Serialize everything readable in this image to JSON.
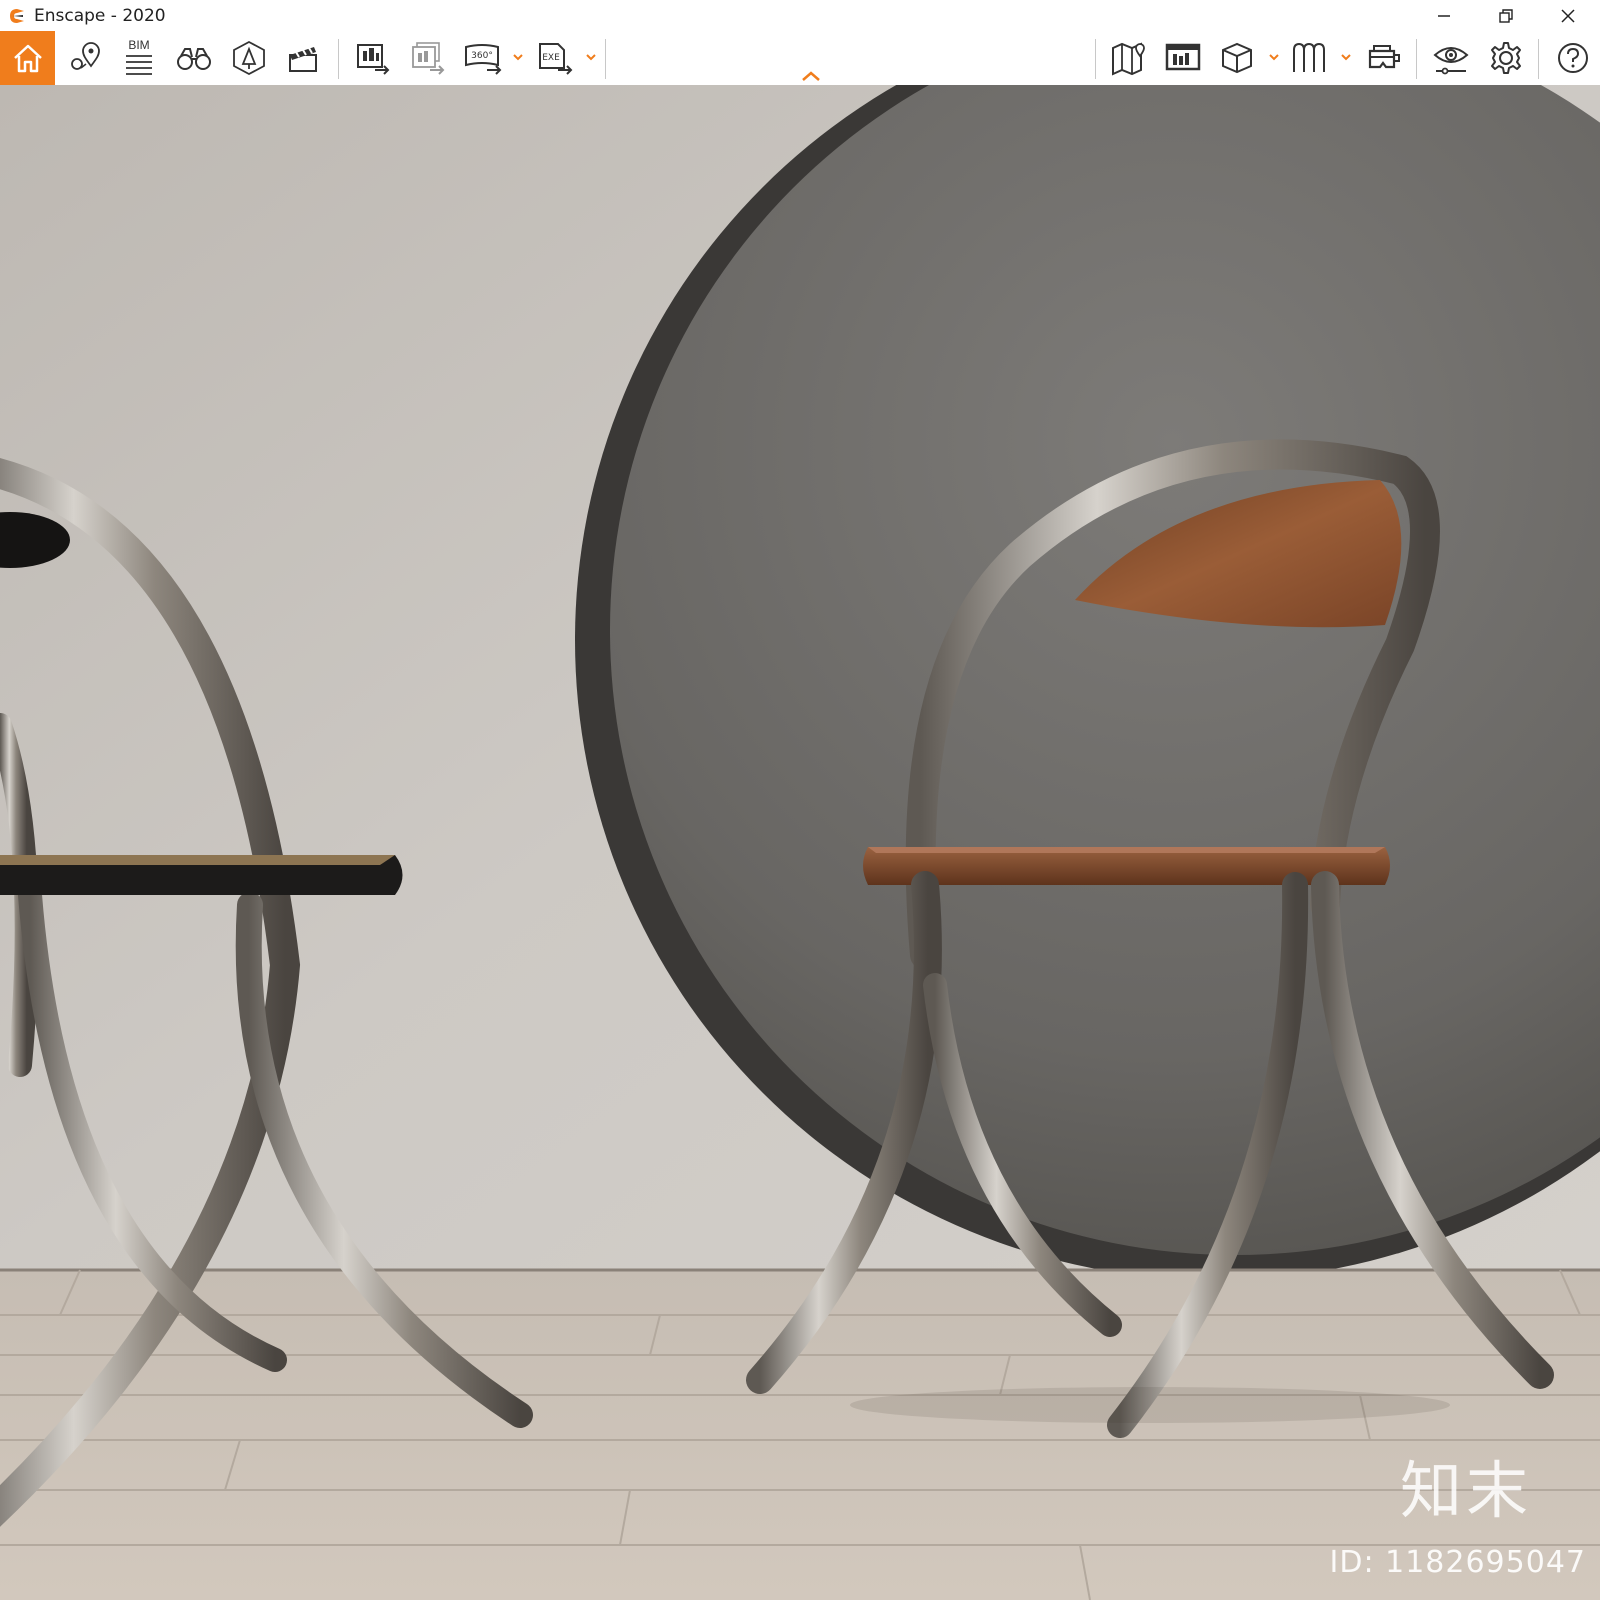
{
  "window": {
    "title": "Enscape - 2020",
    "accent_color": "#f07d1c"
  },
  "toolbar": {
    "left_buttons": [
      {
        "name": "home",
        "icon": "home-icon"
      },
      {
        "name": "views",
        "icon": "location-pin-icon"
      },
      {
        "name": "bim",
        "icon": "bim-list-icon",
        "label": "BIM"
      },
      {
        "name": "binoculars",
        "icon": "binoculars-icon"
      },
      {
        "name": "assets",
        "icon": "asset-library-icon"
      },
      {
        "name": "video",
        "icon": "clapperboard-icon"
      },
      {
        "name": "render-image",
        "icon": "render-image-icon"
      },
      {
        "name": "batch-render",
        "icon": "batch-render-icon"
      },
      {
        "name": "panorama",
        "icon": "panorama-icon",
        "label": "360°"
      },
      {
        "name": "exe-export",
        "icon": "exe-export-icon",
        "label": "EXE"
      }
    ],
    "right_buttons": [
      {
        "name": "map",
        "icon": "map-icon"
      },
      {
        "name": "material-editor",
        "icon": "material-editor-icon"
      },
      {
        "name": "cube",
        "icon": "cube-icon"
      },
      {
        "name": "vr",
        "icon": "vr-icon"
      },
      {
        "name": "headset",
        "icon": "headset-icon"
      },
      {
        "name": "visual-settings",
        "icon": "eye-icon"
      },
      {
        "name": "settings",
        "icon": "gear-icon"
      },
      {
        "name": "help",
        "icon": "help-icon"
      }
    ]
  },
  "viewport": {
    "watermark_text": "知末",
    "watermark_id": "ID: 1182695047",
    "wall_color": "#c9c5c0",
    "disk_color": "#6b6a67",
    "floor_color": "#cbbfb3",
    "wood_color": "#8a5232",
    "chrome_color": "#a8a29b"
  }
}
